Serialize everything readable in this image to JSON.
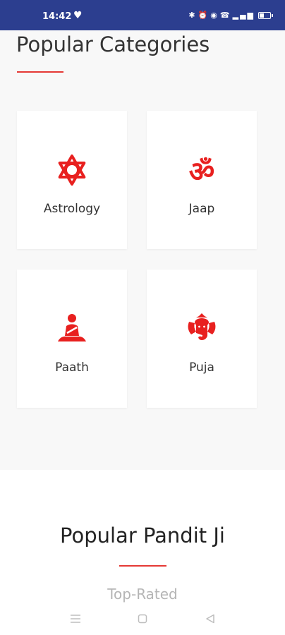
{
  "status_bar": {
    "time": "14:42",
    "left_icons": [
      "heart-icon"
    ],
    "right_icons": [
      "bluetooth-icon",
      "alarm-icon",
      "wifi-icon",
      "call-icon",
      "signal-icon",
      "battery-icon"
    ]
  },
  "categories_section": {
    "title": "Popular Categories",
    "accent_color": "#e53935"
  },
  "categories": [
    {
      "label": "Astrology",
      "icon": "star-of-david-icon"
    },
    {
      "label": "Jaap",
      "icon": "om-icon"
    },
    {
      "label": "Paath",
      "icon": "meditating-person-icon"
    },
    {
      "label": "Puja",
      "icon": "ganesha-icon"
    }
  ],
  "pandit_section": {
    "title": "Popular Pandit Ji",
    "subtitle": "Top-Rated"
  },
  "nav_bar": {
    "buttons": [
      "menu-icon",
      "home-icon",
      "back-icon"
    ]
  },
  "colors": {
    "status_bar": "#2c3e8f",
    "accent": "#e53935",
    "icon_red": "#e8201f"
  }
}
